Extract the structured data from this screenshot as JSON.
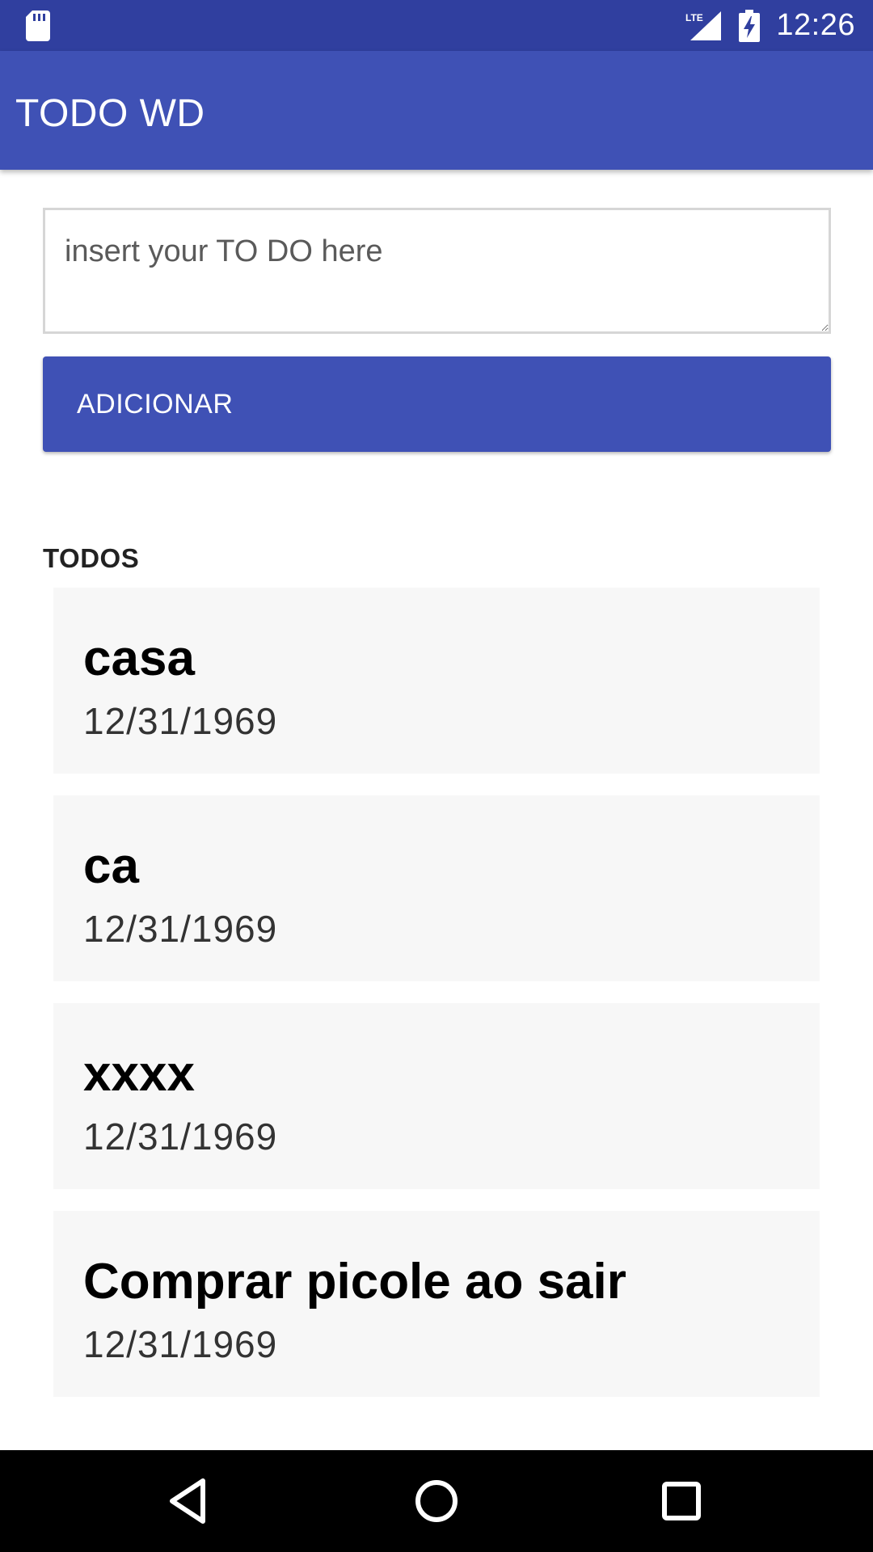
{
  "status_bar": {
    "time": "12:26",
    "network_label": "LTE",
    "icons": [
      "sd-card-icon",
      "lte-signal-icon",
      "battery-charging-icon"
    ]
  },
  "app_bar": {
    "title": "TODO WD",
    "color": "#3f51b5"
  },
  "form": {
    "input_placeholder": "insert your TO DO here",
    "input_value": "",
    "add_button_label": "ADICIONAR"
  },
  "list": {
    "header": "TODOS",
    "items": [
      {
        "title": "casa",
        "date": "12/31/1969"
      },
      {
        "title": "ca",
        "date": "12/31/1969"
      },
      {
        "title": "xxxx",
        "date": "12/31/1969"
      },
      {
        "title": "Comprar picole ao sair",
        "date": "12/31/1969"
      }
    ]
  },
  "nav_bar": {
    "icons": [
      "back-icon",
      "home-icon",
      "recents-icon"
    ]
  },
  "colors": {
    "status_bar": "#303f9f",
    "primary": "#3f51b5",
    "card_bg": "#f7f7f7"
  }
}
